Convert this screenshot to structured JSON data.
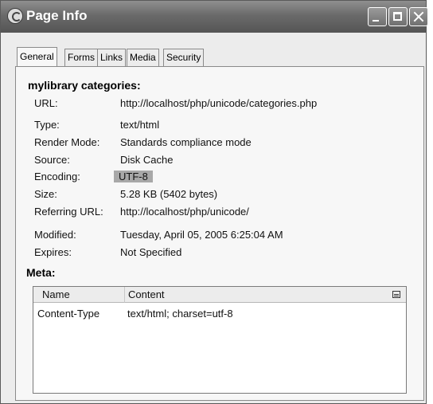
{
  "window": {
    "title": "Page Info",
    "controls": [
      "minimize-icon",
      "maximize-icon",
      "close-icon"
    ]
  },
  "tabs": [
    {
      "label": "General",
      "active": true
    },
    {
      "label": "Forms",
      "active": false
    },
    {
      "label": "Links",
      "active": false
    },
    {
      "label": "Media",
      "active": false
    },
    {
      "label": "Security",
      "active": false
    }
  ],
  "general": {
    "site_title": "mylibrary categories:",
    "fields": {
      "url": {
        "label": "URL:",
        "value": "http://localhost/php/unicode/categories.php"
      },
      "type": {
        "label": "Type:",
        "value": "text/html"
      },
      "render_mode": {
        "label": "Render Mode:",
        "value": "Standards compliance mode"
      },
      "source": {
        "label": "Source:",
        "value": "Disk Cache"
      },
      "encoding": {
        "label": "Encoding:",
        "value": "UTF-8"
      },
      "size": {
        "label": "Size:",
        "value": "5.28 KB (5402 bytes)"
      },
      "referring_url": {
        "label": "Referring URL:",
        "value": "http://localhost/php/unicode/"
      },
      "modified": {
        "label": "Modified:",
        "value": "Tuesday, April 05, 2005 6:25:04 AM"
      },
      "expires": {
        "label": "Expires:",
        "value": "Not Specified"
      }
    }
  },
  "meta": {
    "title": "Meta:",
    "columns": {
      "name": "Name",
      "content": "Content"
    },
    "rows": [
      {
        "name": "Content-Type",
        "content": "text/html; charset=utf-8"
      }
    ]
  }
}
